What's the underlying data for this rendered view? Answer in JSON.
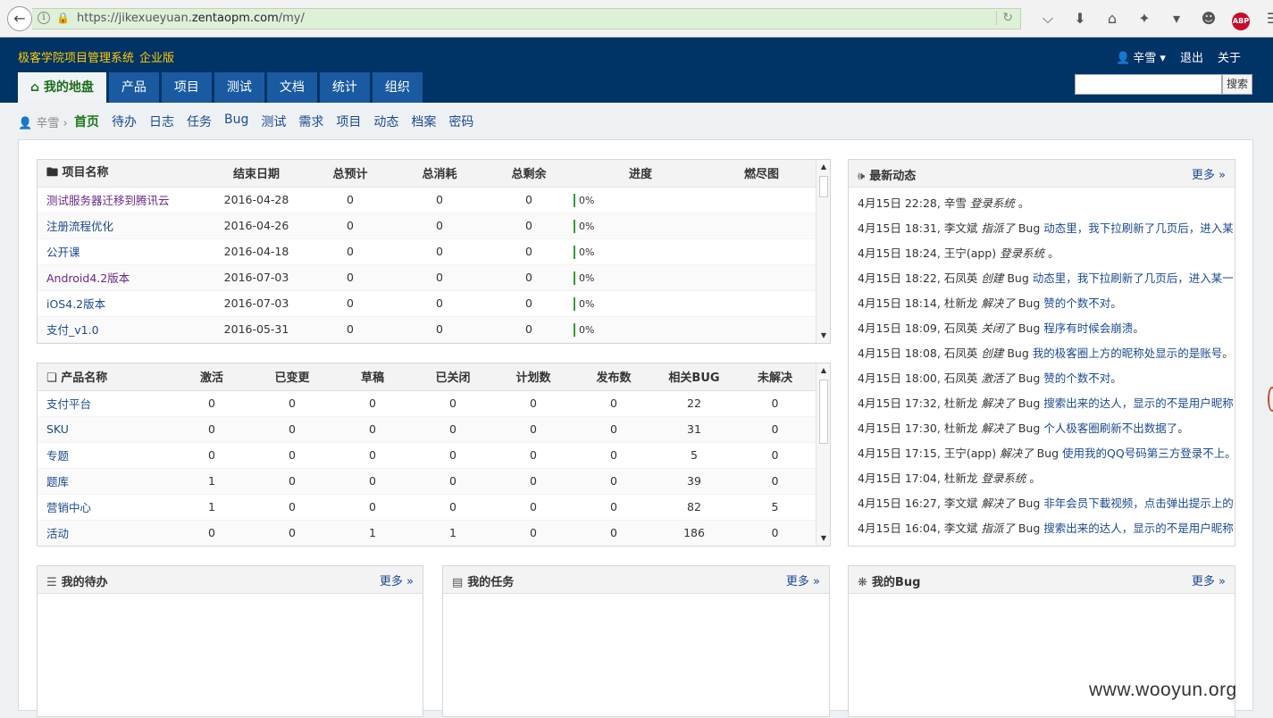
{
  "browser": {
    "url_prefix": "https://jikexueyuan.",
    "url_domain": "zentaopm.com",
    "url_path": "/my/"
  },
  "header": {
    "brand": "极客学院项目管理系统",
    "edition": "企业版",
    "user": "辛雪",
    "logout": "退出",
    "about": "关于",
    "search_button": "搜索",
    "nav": [
      "我的地盘",
      "产品",
      "项目",
      "测试",
      "文档",
      "统计",
      "组织"
    ]
  },
  "subnav": {
    "crumb_user": "辛雪",
    "links": [
      "首页",
      "待办",
      "日志",
      "任务",
      "Bug",
      "测试",
      "需求",
      "项目",
      "动态",
      "档案",
      "密码"
    ]
  },
  "projects": {
    "columns": [
      "项目名称",
      "结束日期",
      "总预计",
      "总消耗",
      "总剩余",
      "进度",
      "燃尽图"
    ],
    "rows": [
      {
        "name": "测试服务器迁移到腾讯云",
        "end": "2016-04-28",
        "estimate": "0",
        "consumed": "0",
        "left": "0",
        "progress": "0%"
      },
      {
        "name": "注册流程优化",
        "end": "2016-04-26",
        "estimate": "0",
        "consumed": "0",
        "left": "0",
        "progress": "0%"
      },
      {
        "name": "公开课",
        "end": "2016-04-18",
        "estimate": "0",
        "consumed": "0",
        "left": "0",
        "progress": "0%"
      },
      {
        "name": "Android4.2版本",
        "end": "2016-07-03",
        "estimate": "0",
        "consumed": "0",
        "left": "0",
        "progress": "0%"
      },
      {
        "name": "iOS4.2版本",
        "end": "2016-07-03",
        "estimate": "0",
        "consumed": "0",
        "left": "0",
        "progress": "0%"
      },
      {
        "name": "支付_v1.0",
        "end": "2016-05-31",
        "estimate": "0",
        "consumed": "0",
        "left": "0",
        "progress": "0%"
      }
    ]
  },
  "products": {
    "columns": [
      "产品名称",
      "激活",
      "已变更",
      "草稿",
      "已关闭",
      "计划数",
      "发布数",
      "相关BUG",
      "未解决"
    ],
    "rows": [
      {
        "name": "支付平台",
        "active": "0",
        "changed": "0",
        "draft": "0",
        "closed": "0",
        "plans": "0",
        "releases": "0",
        "bugs": "22",
        "unresolved": "0"
      },
      {
        "name": "SKU",
        "active": "0",
        "changed": "0",
        "draft": "0",
        "closed": "0",
        "plans": "0",
        "releases": "0",
        "bugs": "31",
        "unresolved": "0"
      },
      {
        "name": "专题",
        "active": "0",
        "changed": "0",
        "draft": "0",
        "closed": "0",
        "plans": "0",
        "releases": "0",
        "bugs": "5",
        "unresolved": "0"
      },
      {
        "name": "题库",
        "active": "1",
        "changed": "0",
        "draft": "0",
        "closed": "0",
        "plans": "0",
        "releases": "0",
        "bugs": "39",
        "unresolved": "0"
      },
      {
        "name": "营销中心",
        "active": "1",
        "changed": "0",
        "draft": "0",
        "closed": "0",
        "plans": "0",
        "releases": "0",
        "bugs": "82",
        "unresolved": "5"
      },
      {
        "name": "活动",
        "active": "0",
        "changed": "0",
        "draft": "1",
        "closed": "1",
        "plans": "0",
        "releases": "0",
        "bugs": "186",
        "unresolved": "0"
      }
    ]
  },
  "activity": {
    "title": "最新动态",
    "more": "更多",
    "items": [
      {
        "time": "4月15日 22:28,",
        "actor": "辛雪",
        "verb": "登录系统",
        "obj": "",
        "link": "",
        "tail": "。"
      },
      {
        "time": "4月15日 18:31,",
        "actor": "李文斌",
        "verb": "指派了",
        "obj": "Bug",
        "link": "动态里，我下拉刷新了几页后，进入某",
        "tail": ""
      },
      {
        "time": "4月15日 18:24,",
        "actor": "王宁(app)",
        "verb": "登录系统",
        "obj": "",
        "link": "",
        "tail": "。"
      },
      {
        "time": "4月15日 18:22,",
        "actor": "石凤英",
        "verb": "创建",
        "obj": "Bug",
        "link": "动态里，我下拉刷新了几页后，进入某一",
        "tail": ""
      },
      {
        "time": "4月15日 18:14,",
        "actor": "杜新龙",
        "verb": "解决了",
        "obj": "Bug",
        "link": "赞的个数不对",
        "tail": "。"
      },
      {
        "time": "4月15日 18:09,",
        "actor": "石凤英",
        "verb": "关闭了",
        "obj": "Bug",
        "link": "程序有时候会崩溃",
        "tail": "。"
      },
      {
        "time": "4月15日 18:08,",
        "actor": "石凤英",
        "verb": "创建",
        "obj": "Bug",
        "link": "我的极客圈上方的昵称处显示的是账号",
        "tail": "。"
      },
      {
        "time": "4月15日 18:00,",
        "actor": "石凤英",
        "verb": "激活了",
        "obj": "Bug",
        "link": "赞的个数不对",
        "tail": "。"
      },
      {
        "time": "4月15日 17:32,",
        "actor": "杜新龙",
        "verb": "解决了",
        "obj": "Bug",
        "link": "搜索出来的达人，显示的不是用户昵称",
        "tail": ""
      },
      {
        "time": "4月15日 17:30,",
        "actor": "杜新龙",
        "verb": "解决了",
        "obj": "Bug",
        "link": "个人极客圈刷新不出数据了",
        "tail": "。"
      },
      {
        "time": "4月15日 17:15,",
        "actor": "王宁(app)",
        "verb": "解决了",
        "obj": "Bug",
        "link": "使用我的QQ号码第三方登录不上",
        "tail": "。"
      },
      {
        "time": "4月15日 17:04,",
        "actor": "杜新龙",
        "verb": "登录系统",
        "obj": "",
        "link": "",
        "tail": "。"
      },
      {
        "time": "4月15日 16:27,",
        "actor": "李文斌",
        "verb": "解决了",
        "obj": "Bug",
        "link": "非年会员下載视频，点击弹出提示上的",
        "tail": ""
      },
      {
        "time": "4月15日 16:04,",
        "actor": "李文斌",
        "verb": "指派了",
        "obj": "Bug",
        "link": "搜索出来的达人，显示的不是用户昵称",
        "tail": ""
      }
    ]
  },
  "bottom_panels": {
    "todo": {
      "title": "我的待办",
      "more": "更多"
    },
    "tasks": {
      "title": "我的任务",
      "more": "更多"
    },
    "bugs": {
      "title": "我的Bug",
      "more": "更多"
    }
  },
  "watermark": "www.wooyun.org"
}
